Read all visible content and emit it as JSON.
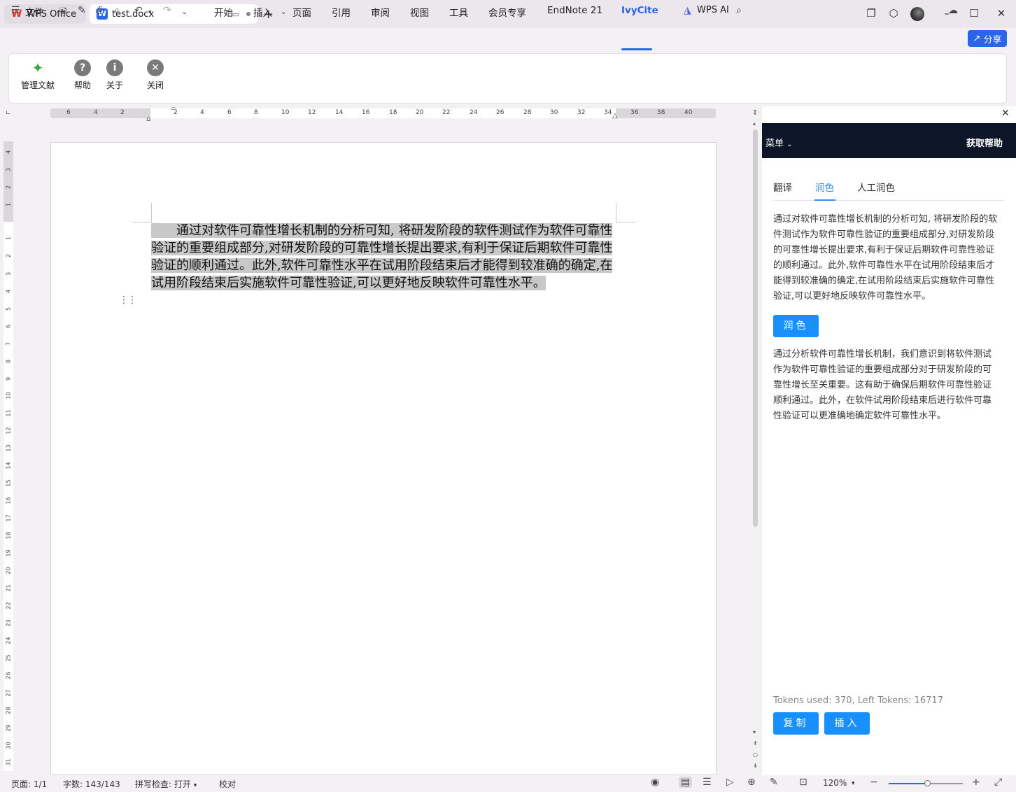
{
  "tabs": [
    {
      "label": "WPS Office"
    },
    {
      "label": "test.docx"
    }
  ],
  "menu": {
    "file": "文件",
    "items": [
      "开始",
      "插入",
      "页面",
      "引用",
      "审阅",
      "视图",
      "工具",
      "会员专享",
      "EndNote 21",
      "IvyCite"
    ],
    "active": "IvyCite",
    "wps_ai": "WPS AI",
    "share": "分享"
  },
  "ribbon": {
    "buttons": [
      "管理文献",
      "帮助",
      "关于",
      "关闭"
    ]
  },
  "ruler": {
    "h_labels": [
      "6",
      "4",
      "2",
      "2",
      "4",
      "6",
      "8",
      "10",
      "12",
      "14",
      "16",
      "18",
      "20",
      "22",
      "24",
      "26",
      "28",
      "30",
      "32",
      "34",
      "36",
      "38",
      "40"
    ],
    "v_labels": [
      "4",
      "3",
      "2",
      "1",
      "1",
      "2",
      "3",
      "4",
      "5",
      "6",
      "7",
      "8",
      "9",
      "10",
      "11",
      "12",
      "13",
      "14",
      "15",
      "16",
      "17",
      "18",
      "19",
      "20",
      "21",
      "22",
      "23",
      "24",
      "25",
      "26",
      "27",
      "28",
      "29",
      "30",
      "31"
    ]
  },
  "document": {
    "paragraph": "　　通过对软件可靠性增长机制的分析可知, 将研发阶段的软件测试作为软件可靠性验证的重要组成部分,对研发阶段的可靠性增长提出要求,有利于保证后期软件可靠性验证的顺利通过。此外,软件可靠性水平在试用阶段结束后才能得到较准确的确定,在试用阶段结束后实施软件可靠性验证,可以更好地反映软件可靠性水平。"
  },
  "pane": {
    "menu": "菜单",
    "help": "获取帮助",
    "tabs": [
      "翻译",
      "润色",
      "人工润色"
    ],
    "active_tab": "润色",
    "source_text": "通过对软件可靠性增长机制的分析可知, 将研发阶段的软件测试作为软件可靠性验证的重要组成部分,对研发阶段的可靠性增长提出要求,有利于保证后期软件可靠性验证的顺利通过。此外,软件可靠性水平在试用阶段结束后才能得到较准确的确定,在试用阶段结束后实施软件可靠性验证,可以更好地反映软件可靠性水平。",
    "polish_button": "润色",
    "result_text": "通过分析软件可靠性增长机制，我们意识到将软件测试作为软件可靠性验证的重要组成部分对于研发阶段的可靠性增长至关重要。这有助于确保后期软件可靠性验证顺利通过。此外，在软件试用阶段结束后进行软件可靠性验证可以更准确地确定软件可靠性水平。",
    "tokens": "Tokens used: 370, Left Tokens: 16717",
    "copy_button": "复制",
    "insert_button": "插入"
  },
  "status": {
    "page": "页面: 1/1",
    "words": "字数: 143/143",
    "spell": "拼写检查: 打开",
    "proof": "校对",
    "zoom": "120%"
  },
  "colors": {
    "accent": "#2a64e8",
    "pane_header": "#0d1628",
    "pane_button": "#1890ff"
  }
}
